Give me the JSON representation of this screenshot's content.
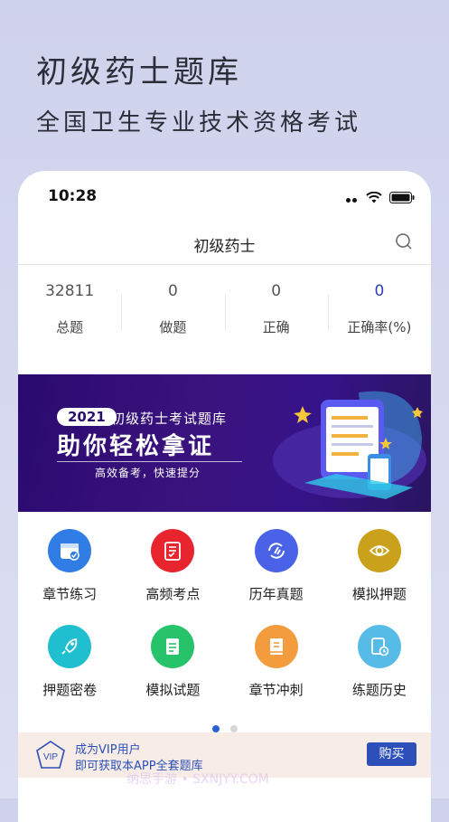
{
  "hero": {
    "title": "初级药士题库",
    "subtitle": "全国卫生专业技术资格考试"
  },
  "status": {
    "time": "10:28"
  },
  "nav": {
    "title": "初级药士"
  },
  "stats": [
    {
      "value": "32811",
      "label": "总题"
    },
    {
      "value": "0",
      "label": "做题"
    },
    {
      "value": "0",
      "label": "正确"
    },
    {
      "value": "0",
      "label": "正确率(%)"
    }
  ],
  "banner": {
    "year": "2021",
    "line1": "初级药士考试题库",
    "headline": "助你轻松拿证",
    "line2": "高效备考，快速提分"
  },
  "grid": [
    {
      "label": "章节练习",
      "icon": "calendar-check-icon",
      "color": "#2f7de5"
    },
    {
      "label": "高频考点",
      "icon": "checklist-icon",
      "color": "#e8242e"
    },
    {
      "label": "历年真题",
      "icon": "history-refresh-icon",
      "color": "#4a62e8"
    },
    {
      "label": "模拟押题",
      "icon": "eye-icon",
      "color": "#c9a11a"
    },
    {
      "label": "押题密卷",
      "icon": "rocket-icon",
      "color": "#1fbfd0"
    },
    {
      "label": "模拟试题",
      "icon": "document-icon",
      "color": "#26c36b"
    },
    {
      "label": "章节冲刺",
      "icon": "book-icon",
      "color": "#f29c3d"
    },
    {
      "label": "练题历史",
      "icon": "clock-document-icon",
      "color": "#57bbe8"
    }
  ],
  "vip": {
    "line1": "成为VIP用户",
    "line2": "即可获取本APP全套题库",
    "button": "购买",
    "badge": "VIP"
  },
  "watermark": "纳思手游 • SXNJYY.COM",
  "colors": {
    "accent": "#2c4fb9"
  }
}
